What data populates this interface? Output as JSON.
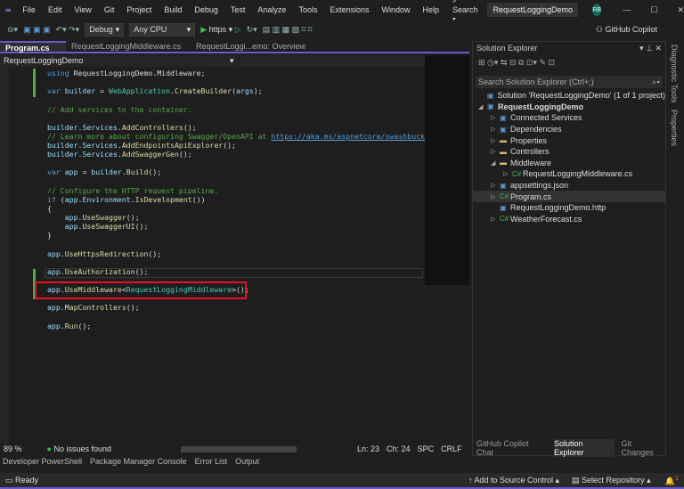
{
  "title_bar": {
    "menus": [
      "File",
      "Edit",
      "View",
      "Git",
      "Project",
      "Build",
      "Debug",
      "Test",
      "Analyze",
      "Tools",
      "Extensions",
      "Window",
      "Help"
    ],
    "search": "Search",
    "solution_name": "RequestLoggingDemo",
    "avatar": "RB"
  },
  "toolbar": {
    "configuration": "Debug",
    "platform": "Any CPU",
    "run_target": "https",
    "copilot": "GitHub Copilot"
  },
  "tabs": [
    {
      "label": "Program.cs",
      "active": true
    },
    {
      "label": "RequestLoggingMiddleware.cs"
    },
    {
      "label": "RequestLoggi...emo: Overview"
    }
  ],
  "nav": {
    "project": "RequestLoggingDemo"
  },
  "code": [
    [
      [
        "kw",
        "using "
      ],
      [
        "pl",
        "RequestLoggingDemo.Middleware;"
      ]
    ],
    [],
    [
      [
        "kw",
        "var "
      ],
      [
        "id",
        "builder"
      ],
      [
        "pl",
        " = "
      ],
      [
        "ty",
        "WebApplication"
      ],
      [
        "pl",
        "."
      ],
      [
        "fn",
        "CreateBuilder"
      ],
      [
        "pl",
        "("
      ],
      [
        "id",
        "args"
      ],
      [
        "pl",
        ");"
      ]
    ],
    [],
    [
      [
        "cm",
        "// Add services to the container."
      ]
    ],
    [],
    [
      [
        "id",
        "builder"
      ],
      [
        "pl",
        "."
      ],
      [
        "id",
        "Services"
      ],
      [
        "pl",
        "."
      ],
      [
        "fn",
        "AddControllers"
      ],
      [
        "pl",
        "();"
      ]
    ],
    [
      [
        "cm",
        "// Learn more about configuring Swagger/OpenAPI at "
      ],
      [
        "ln",
        "https://aka.ms/aspnetcore/swashbuckle"
      ]
    ],
    [
      [
        "id",
        "builder"
      ],
      [
        "pl",
        "."
      ],
      [
        "id",
        "Services"
      ],
      [
        "pl",
        "."
      ],
      [
        "fn",
        "AddEndpointsApiExplorer"
      ],
      [
        "pl",
        "();"
      ]
    ],
    [
      [
        "id",
        "builder"
      ],
      [
        "pl",
        "."
      ],
      [
        "id",
        "Services"
      ],
      [
        "pl",
        "."
      ],
      [
        "fn",
        "AddSwaggerGen"
      ],
      [
        "pl",
        "();"
      ]
    ],
    [],
    [
      [
        "kw",
        "var "
      ],
      [
        "id",
        "app"
      ],
      [
        "pl",
        " = "
      ],
      [
        "id",
        "builder"
      ],
      [
        "pl",
        "."
      ],
      [
        "fn",
        "Build"
      ],
      [
        "pl",
        "();"
      ]
    ],
    [],
    [
      [
        "cm",
        "// Configure the HTTP request pipeline."
      ]
    ],
    [
      [
        "kw",
        "if "
      ],
      [
        "pl",
        "("
      ],
      [
        "id",
        "app"
      ],
      [
        "pl",
        "."
      ],
      [
        "id",
        "Environment"
      ],
      [
        "pl",
        "."
      ],
      [
        "fn",
        "IsDevelopment"
      ],
      [
        "pl",
        "())"
      ]
    ],
    [
      [
        "pl",
        "{"
      ]
    ],
    [
      [
        "pl",
        "    "
      ],
      [
        "id",
        "app"
      ],
      [
        "pl",
        "."
      ],
      [
        "fn",
        "UseSwagger"
      ],
      [
        "pl",
        "();"
      ]
    ],
    [
      [
        "pl",
        "    "
      ],
      [
        "id",
        "app"
      ],
      [
        "pl",
        "."
      ],
      [
        "fn",
        "UseSwaggerUI"
      ],
      [
        "pl",
        "();"
      ]
    ],
    [
      [
        "pl",
        "}"
      ]
    ],
    [],
    [
      [
        "id",
        "app"
      ],
      [
        "pl",
        "."
      ],
      [
        "fn",
        "UseHttpsRedirection"
      ],
      [
        "pl",
        "();"
      ]
    ],
    [],
    [
      [
        "id",
        "app"
      ],
      [
        "pl",
        "."
      ],
      [
        "fn",
        "UseAuthorization"
      ],
      [
        "pl",
        "();"
      ]
    ],
    [],
    [
      [
        "id",
        "app"
      ],
      [
        "pl",
        "."
      ],
      [
        "fn",
        "UseMiddleware"
      ],
      [
        "pl",
        "<"
      ],
      [
        "ty",
        "RequestLoggingMiddleware"
      ],
      [
        "pl",
        ">();"
      ]
    ],
    [],
    [
      [
        "id",
        "app"
      ],
      [
        "pl",
        "."
      ],
      [
        "fn",
        "MapControllers"
      ],
      [
        "pl",
        "();"
      ]
    ],
    [],
    [
      [
        "id",
        "app"
      ],
      [
        "pl",
        "."
      ],
      [
        "fn",
        "Run"
      ],
      [
        "pl",
        "();"
      ]
    ]
  ],
  "editor_status": {
    "zoom": "89 %",
    "issues": "No issues found",
    "line": "Ln: 23",
    "col": "Ch: 24",
    "spacing": "SPC",
    "eol": "CRLF"
  },
  "bottom_tabs": [
    "Developer PowerShell",
    "Package Manager Console",
    "Error List",
    "Output"
  ],
  "solution_explorer": {
    "title": "Solution Explorer",
    "search_placeholder": "Search Solution Explorer (Ctrl+;)",
    "items": [
      {
        "label": "Solution 'RequestLoggingDemo' (1 of 1 project)",
        "depth": 0,
        "arrow": "",
        "icon": "solution-icon"
      },
      {
        "label": "RequestLoggingDemo",
        "depth": 0,
        "arrow": "◢",
        "icon": "project-icon",
        "bold": true
      },
      {
        "label": "Connected Services",
        "depth": 1,
        "arrow": "▷",
        "icon": "cloud-icon"
      },
      {
        "label": "Dependencies",
        "depth": 1,
        "arrow": "▷",
        "icon": "dependencies-icon"
      },
      {
        "label": "Properties",
        "depth": 1,
        "arrow": "▷",
        "icon": "folder-icon"
      },
      {
        "label": "Controllers",
        "depth": 1,
        "arrow": "▷",
        "icon": "folder-icon"
      },
      {
        "label": "Middleware",
        "depth": 1,
        "arrow": "◢",
        "icon": "folder-icon"
      },
      {
        "label": "RequestLoggingMiddleware.cs",
        "depth": 2,
        "arrow": "▷",
        "icon": "csharp-icon"
      },
      {
        "label": "appsettings.json",
        "depth": 1,
        "arrow": "▷",
        "icon": "json-icon"
      },
      {
        "label": "Program.cs",
        "depth": 1,
        "arrow": "▷",
        "icon": "csharp-icon",
        "selected": true
      },
      {
        "label": "RequestLoggingDemo.http",
        "depth": 1,
        "arrow": "",
        "icon": "http-icon"
      },
      {
        "label": "WeatherForecast.cs",
        "depth": 1,
        "arrow": "▷",
        "icon": "csharp-icon"
      }
    ],
    "tabs": [
      "GitHub Copilot Chat",
      "Solution Explorer",
      "Git Changes"
    ]
  },
  "side_tabs": [
    "Diagnostic Tools",
    "Properties"
  ],
  "status_bar": {
    "status": "Ready",
    "source_control": "Add to Source Control",
    "repository": "Select Repository",
    "notifications": "1"
  },
  "colors": {
    "accent": "#6a5acd",
    "highlight_box": "#e81123",
    "change_bar": "#57a64a"
  }
}
